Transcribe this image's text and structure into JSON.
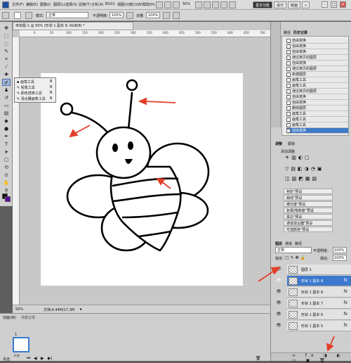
{
  "menu": {
    "items": [
      "文件(F)",
      "编辑(E)",
      "图像(I)",
      "图层(L)",
      "选择(S)",
      "滤镜(T)",
      "分析(A)",
      "3D(D)",
      "视图(V)",
      "窗口(W)",
      "帮助(H)"
    ],
    "zoom": "50%",
    "workspace_active": "基本功能",
    "workspace_tabs": [
      "设计",
      "绘画"
    ]
  },
  "options": {
    "mode_label": "模式:",
    "mode_value": "正常",
    "opacity_label": "不透明度:",
    "opacity_value": "100%",
    "flow_label": "流量:",
    "flow_value": "100%"
  },
  "document": {
    "tab_title": "未标题-1 @ 50% (形状 1 副本 8, RGB/8) *",
    "status_zoom": "50%",
    "status_doc": "文档:4.44M/17.3M"
  },
  "ruler": {
    "top": [
      "0",
      "50",
      "100",
      "150",
      "200",
      "250",
      "300",
      "350",
      "400",
      "450",
      "500",
      "550",
      "600",
      "650",
      "700"
    ]
  },
  "flyout": {
    "items": [
      "画笔工具",
      "铅笔工具",
      "颜色替换工具",
      "混合器画笔工具"
    ],
    "shortcut": "B"
  },
  "panels": {
    "history_tabs": [
      "路径",
      "历史记录"
    ],
    "history_items": [
      "自由变换",
      "自由变换",
      "自由变换",
      "通过拷贝的图层",
      "自由变换",
      "通过拷贝的图层",
      "新建图层",
      "画笔工具",
      "画笔工具",
      "通过拷贝的图层",
      "自由变换",
      "自由变换",
      "删除图层",
      "画笔工具",
      "画笔工具",
      "画笔工具",
      "自由变换"
    ],
    "history_selected_index": 16,
    "adjust_tabs": [
      "调整",
      "蒙版"
    ],
    "adjust_title": "添加调整",
    "presets": [
      "色阶\"预设",
      "曲线\"预设",
      "曝光度\"预设",
      "色相/饱和度\"预设",
      "黑白\"预设",
      "通道混合器\"预设",
      "可选颜色\"预设"
    ],
    "layers_tabs": [
      "图层",
      "通道",
      "路径"
    ],
    "blend_mode": "正常",
    "opacity_label": "不透明度:",
    "opacity_value": "100%",
    "lock_label": "锁定:",
    "fill_label": "填充:",
    "fill_value": "100%",
    "layers": [
      "图层 1",
      "形状 1 副本 8",
      "形状 1 副本 8",
      "形状 1 副本 7",
      "形状 1 副本 6",
      "形状 1 副本 5"
    ],
    "layer_selected_index": 1,
    "fx_label": "fx"
  },
  "anim": {
    "tabs": [
      "动画(帧)",
      "测量记录"
    ],
    "frame_num": "1",
    "frame_time": "0 秒",
    "loop": "永远"
  },
  "colors": {
    "canvas": "#ffffff",
    "selection": "#3a79cf",
    "arrow": "#e2402a"
  }
}
